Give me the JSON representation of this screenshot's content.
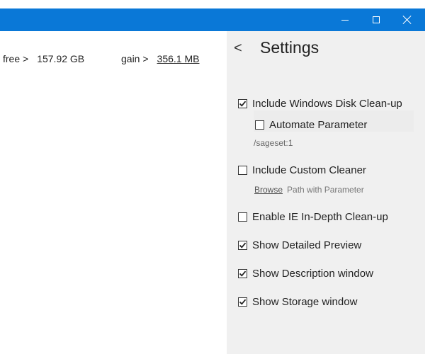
{
  "main": {
    "free_label": "free >",
    "free_value": "157.92 GB",
    "gain_label": "gain >",
    "gain_value": "356.1 MB"
  },
  "settings": {
    "back_label": "<",
    "title": "Settings",
    "options": [
      {
        "label": "Include Windows Disk Clean-up",
        "checked": true
      },
      {
        "label": "Automate Parameter",
        "checked": false
      },
      {
        "label": "Include Custom Cleaner",
        "checked": false
      },
      {
        "label": "Enable IE In-Depth Clean-up",
        "checked": false
      },
      {
        "label": "Show Detailed Preview",
        "checked": true
      },
      {
        "label": "Show Description window",
        "checked": true
      },
      {
        "label": "Show Storage window",
        "checked": true
      }
    ],
    "sageset_param": "/sageset:1",
    "browse_label": "Browse",
    "path_hint": "Path with Parameter"
  },
  "colors": {
    "titlebar": "#0a78d7",
    "settings_bg": "#f0f0f0"
  }
}
